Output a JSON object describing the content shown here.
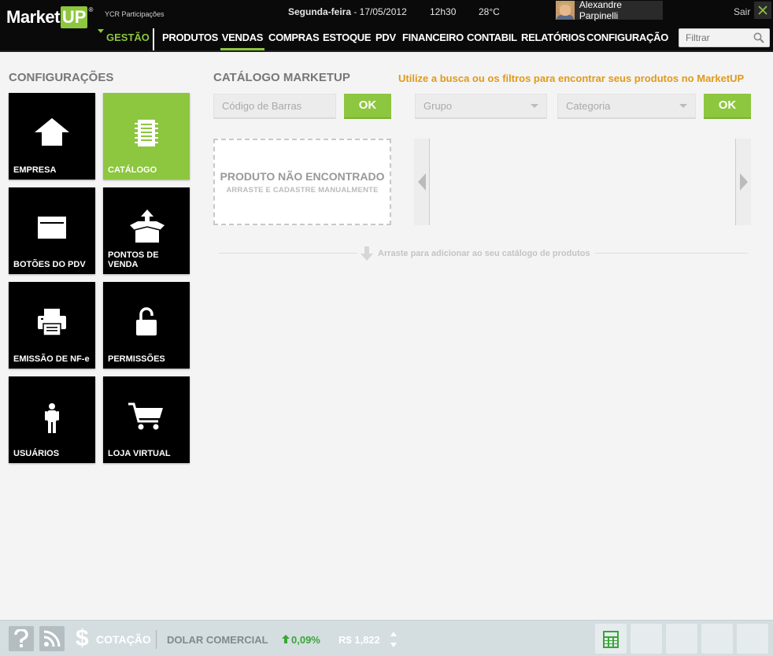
{
  "header": {
    "logo_text": "Market",
    "logo_up": "UP",
    "logo_reg": "®",
    "company": "YCR Participações",
    "weekday": "Segunda-feira",
    "date": " - 17/05/2012",
    "time": "12h30",
    "temperature": "28°C",
    "user_name": "Alexandre Parpinelli",
    "logout": "Sair"
  },
  "nav": {
    "gestao": "GESTÃO",
    "items": [
      "PRODUTOS",
      "VENDAS",
      "COMPRAS",
      "ESTOQUE",
      "PDV",
      "FINANCEIRO",
      "CONTABIL",
      "RELATÓRIOS",
      "CONFIGURAÇÃO"
    ],
    "active": "VENDAS",
    "filter_placeholder": "Filtrar"
  },
  "sidebar": {
    "title": "CONFIGURAÇÕES",
    "tiles": [
      {
        "label": "EMPRESA",
        "icon": "house-icon",
        "active": false
      },
      {
        "label": "CATÁLOGO",
        "icon": "catalog-icon",
        "active": true
      },
      {
        "label": "BOTÕES DO PDV",
        "icon": "window-icon",
        "active": false
      },
      {
        "label": "PONTOS DE VENDA",
        "icon": "box-upload-icon",
        "active": false
      },
      {
        "label": "EMISSÃO DE NF-e",
        "icon": "printer-icon",
        "active": false
      },
      {
        "label": "PERMISSÕES",
        "icon": "unlock-icon",
        "active": false
      },
      {
        "label": "USUÁRIOS",
        "icon": "person-icon",
        "active": false
      },
      {
        "label": "LOJA VIRTUAL",
        "icon": "cart-icon",
        "active": false
      }
    ]
  },
  "main": {
    "title": "CATÁLOGO MARKETUP",
    "hint": "Utilize a busca ou os filtros para encontrar seus produtos no MarketUP",
    "barcode_placeholder": "Código de Barras",
    "ok_label": "OK",
    "group_label": "Grupo",
    "category_label": "Categoria",
    "ok2_label": "OK",
    "not_found_title": "PRODUTO NÃO ENCONTRADO",
    "not_found_sub": "ARRASTE E CADASTRE MANUALMENTE",
    "drag_hint": "Arraste para adicionar ao seu catálogo de produtos"
  },
  "footer": {
    "currency_symbol": "$",
    "cotacao": "COTAÇÃO",
    "dolar": "DOLAR COMERCIAL",
    "change": "0,09%",
    "value": "R$ 1,822"
  },
  "colors": {
    "accent_green": "#8dc63f",
    "hint_orange": "#e09a1c",
    "positive_green": "#3aa537"
  }
}
